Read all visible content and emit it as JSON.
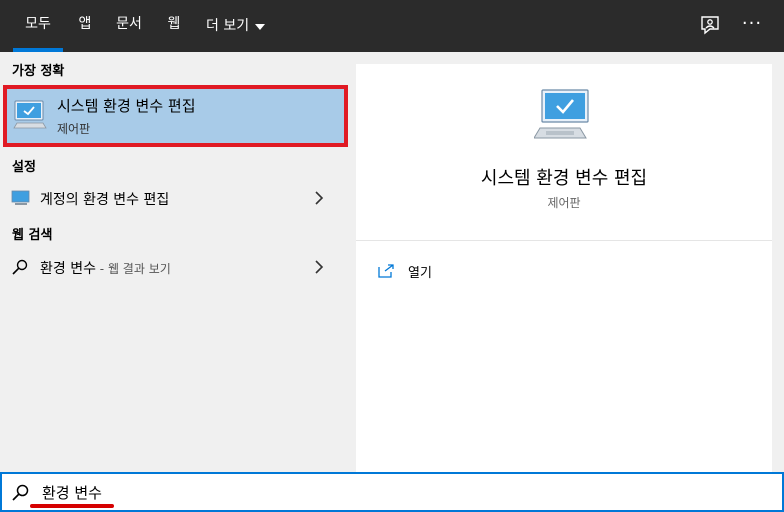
{
  "tabs": [
    {
      "label": "모두",
      "active": true
    },
    {
      "label": "앱"
    },
    {
      "label": "문서"
    },
    {
      "label": "웹"
    },
    {
      "label": "더 보기"
    }
  ],
  "topbar": {
    "feedback_icon": "feedback-icon",
    "more_icon": "more-options-icon",
    "more_label": "···"
  },
  "left": {
    "best_match_title": "가장 정확",
    "best_match": {
      "title": "시스템 환경 변수 편집",
      "subtitle": "제어판",
      "icon": "computer-icon"
    },
    "settings_title": "설정",
    "settings_item": {
      "label": "계정의 환경 변수 편집",
      "icon": "monitor-icon"
    },
    "web_title": "웹 검색",
    "web_item": {
      "label": "환경 변수",
      "suffix": " - 웹 결과 보기",
      "icon": "search-icon"
    }
  },
  "right": {
    "title": "시스템 환경 변수 편집",
    "subtitle": "제어판",
    "open_label": "열기",
    "icon": "computer-icon"
  },
  "search": {
    "value": "환경 변수"
  },
  "colors": {
    "accent": "#0078d7",
    "highlight": "#a8cbe8",
    "callout": "#e01a24"
  }
}
